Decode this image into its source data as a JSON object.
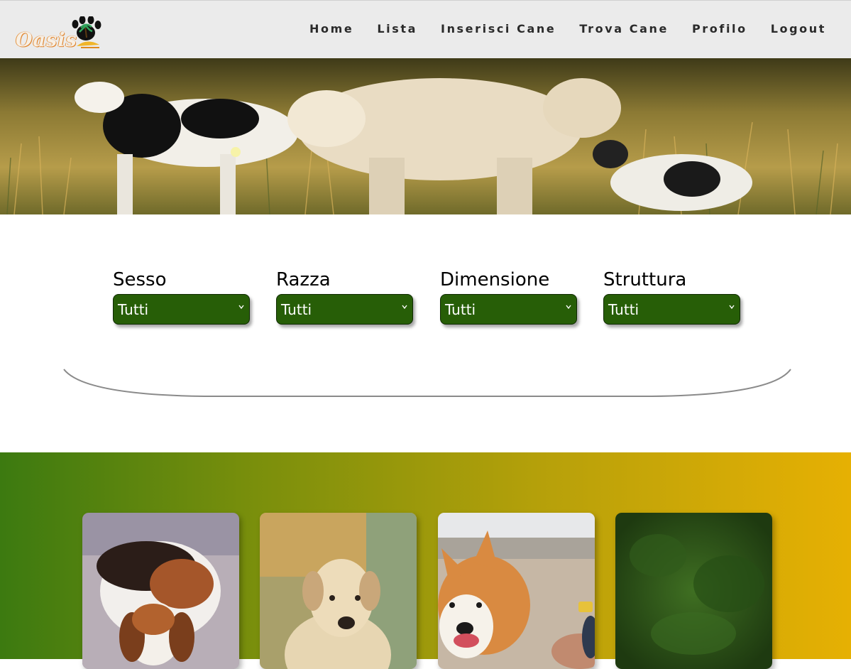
{
  "brand": {
    "name": "Oasis",
    "accent": "#275e07"
  },
  "nav": {
    "items": [
      {
        "label": "Home"
      },
      {
        "label": "Lista"
      },
      {
        "label": "Inserisci Cane"
      },
      {
        "label": "Trova Cane"
      },
      {
        "label": "Profilo"
      },
      {
        "label": "Logout"
      }
    ]
  },
  "filters": [
    {
      "label": "Sesso",
      "value": "Tutti"
    },
    {
      "label": "Razza",
      "value": "Tutti"
    },
    {
      "label": "Dimensione",
      "value": "Tutti"
    },
    {
      "label": "Struttura",
      "value": "Tutti"
    }
  ],
  "cards": [
    {
      "icon": "beagle-photo"
    },
    {
      "icon": "labrador-photo"
    },
    {
      "icon": "corgi-photo"
    },
    {
      "icon": "foliage-photo"
    }
  ]
}
